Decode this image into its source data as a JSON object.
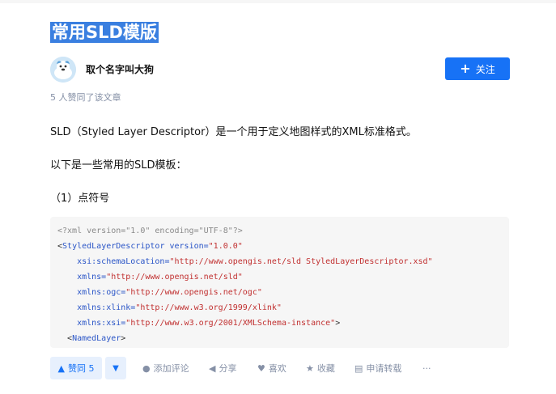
{
  "article": {
    "title": "常用SLD模版",
    "likes_summary": "5 人赞同了该文章",
    "paragraphs": [
      "SLD（Styled Layer Descriptor）是一个用于定义地图样式的XML标准格式。",
      "以下是一些常用的SLD模板：",
      "（1）点符号"
    ]
  },
  "author": {
    "name": "取个名字叫大狗",
    "follow_label": "关注",
    "avatar_icon": "avatar-icon"
  },
  "code": {
    "lines": [
      [
        {
          "t": "<?xml version=\"1.0\" encoding=\"UTF-8\"?>",
          "c": "gray"
        }
      ],
      [
        {
          "t": "<",
          "c": "dark"
        },
        {
          "t": "StyledLayerDescriptor",
          "c": "blue"
        },
        {
          "t": " version=",
          "c": "blue"
        },
        {
          "t": "\"1.0.0\"",
          "c": "red"
        }
      ],
      [
        {
          "t": "    xsi:schemaLocation=",
          "c": "blue"
        },
        {
          "t": "\"http://www.opengis.net/sld StyledLayerDescriptor.xsd\"",
          "c": "red"
        }
      ],
      [
        {
          "t": "    xmlns=",
          "c": "blue"
        },
        {
          "t": "\"http://www.opengis.net/sld\"",
          "c": "red"
        }
      ],
      [
        {
          "t": "    xmlns:ogc=",
          "c": "blue"
        },
        {
          "t": "\"http://www.opengis.net/ogc\"",
          "c": "red"
        }
      ],
      [
        {
          "t": "    xmlns:xlink=",
          "c": "blue"
        },
        {
          "t": "\"http://www.w3.org/1999/xlink\"",
          "c": "red"
        }
      ],
      [
        {
          "t": "    xmlns:xsi=",
          "c": "blue"
        },
        {
          "t": "\"http://www.w3.org/2001/XMLSchema-instance\"",
          "c": "red"
        },
        {
          "t": ">",
          "c": "dark"
        }
      ],
      [
        {
          "t": "  <",
          "c": "dark"
        },
        {
          "t": "NamedLayer",
          "c": "blue"
        },
        {
          "t": ">",
          "c": "dark"
        }
      ]
    ]
  },
  "actions": {
    "vote_up_label": "赞同 5",
    "comment_label": "添加评论",
    "share_label": "分享",
    "like_label": "喜欢",
    "favorite_label": "收藏",
    "repost_label": "申请转载",
    "more_label": "···"
  },
  "colors": {
    "accent": "#1772f6",
    "title_highlight": "#3a7fe0",
    "muted": "#8590a6",
    "code_bg": "#f6f6f6"
  }
}
